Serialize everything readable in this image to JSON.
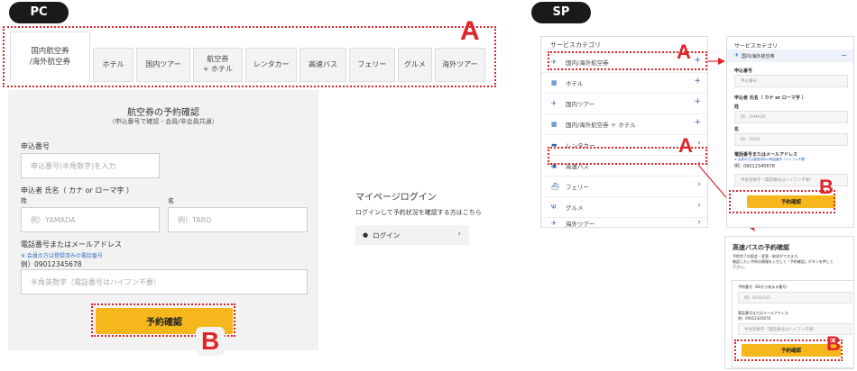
{
  "labels": {
    "pc": "PC",
    "sp": "SP",
    "a": "A",
    "b": "B"
  },
  "pc_tabs": [
    {
      "label": "国内航空券\n/海外航空券",
      "active": true
    },
    {
      "label": "ホテル"
    },
    {
      "label": "国内ツアー"
    },
    {
      "label": "航空券\n+ ホテル"
    },
    {
      "label": "レンタカー"
    },
    {
      "label": "高速バス"
    },
    {
      "label": "フェリー"
    },
    {
      "label": "グルメ"
    },
    {
      "label": "海外ツアー"
    }
  ],
  "pc_form": {
    "title": "航空券の予約確認",
    "subtitle": "（申込番号で確認 - 会員/非会員共通）",
    "app_no_label": "申込番号",
    "app_no_placeholder": "申込番号(半角数字)を入力",
    "name_label": "申込者 氏名（ カナ or ローマ字 ）",
    "last_label": "姓",
    "last_placeholder": "例）YAMADA",
    "first_label": "名",
    "first_placeholder": "例）TARO",
    "contact_label": "電話番号またはメールアドレス",
    "contact_note": "※ 会員の方は登録済みの電話番号",
    "contact_example": "例）09012345678",
    "contact_placeholder": "半角英数字（電話番号はハイフン不要）",
    "submit": "予約確認"
  },
  "mypage": {
    "title": "マイページログイン",
    "desc": "ログインして予約状況を確認する方はこちら",
    "login": "ログイン"
  },
  "sp_categories": {
    "head": "サービスカテゴリ",
    "items": [
      {
        "icon": "✈",
        "label": "国内/海外航空券",
        "end": "+"
      },
      {
        "icon": "▦",
        "label": "ホテル",
        "end": "+"
      },
      {
        "icon": "✈",
        "label": "国内ツアー",
        "end": "+"
      },
      {
        "icon": "▦",
        "label": "国内/海外航空券 ＋ ホテル",
        "end": "+"
      },
      {
        "icon": "▬",
        "label": "レンタカー",
        "end": "›"
      },
      {
        "icon": "▣",
        "label": "高速バス",
        "end": "›"
      },
      {
        "icon": "⛴",
        "label": "フェリー",
        "end": "›"
      },
      {
        "icon": "Ψ",
        "label": "グルメ",
        "end": "›"
      },
      {
        "icon": "✈",
        "label": "海外ツアー",
        "end": "›"
      }
    ]
  },
  "sp_form": {
    "head": "サービスカテゴリ",
    "cat": "国内/海外航空券",
    "minus": "−",
    "app_no_label": "申込番号",
    "app_no_placeholder": "申込番号",
    "name_label": "申込者 氏名（ カナ or ローマ字 ）",
    "last_label": "姓",
    "last_placeholder": "例）YAMADA",
    "first_label": "名",
    "first_placeholder": "例）TARO",
    "contact_label": "電話番号またはメールアドレス",
    "contact_note": "※ 会員の方は登録済みの電話番号（ハイフン不要）",
    "contact_example": "例）09012345678",
    "contact_placeholder": "半角英数字（電話番号はハイフン不要）",
    "submit": "予約確認"
  },
  "sp_bus": {
    "title": "高速バスの予約確認",
    "desc1": "予約完了の照会・変更・取消ができます。",
    "desc2": "確認したい予約の情報を入力して「予約確認」ボタンを押して",
    "desc3": "下さい。",
    "app_no_label": "予約番号（BSから始まる番号）",
    "app_no_placeholder": "例）8910345",
    "contact_label": "電話番号またはメールアドレス",
    "contact_example": "例）09012345678",
    "contact_placeholder": "半角英数字（電話番号はハイフン不要）",
    "submit": "予約確認"
  },
  "colors": {
    "accent": "#e0242a",
    "button": "#f5b71c",
    "link": "#2d62b8"
  }
}
